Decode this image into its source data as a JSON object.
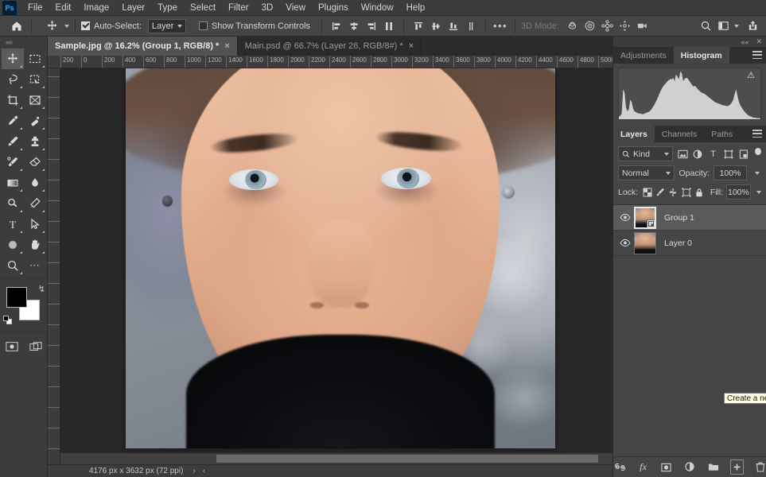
{
  "app": {
    "name": "Adobe Photoshop",
    "logo_text": "Ps"
  },
  "menubar": {
    "items": [
      {
        "label": "File"
      },
      {
        "label": "Edit"
      },
      {
        "label": "Image"
      },
      {
        "label": "Layer"
      },
      {
        "label": "Type"
      },
      {
        "label": "Select"
      },
      {
        "label": "Filter"
      },
      {
        "label": "3D"
      },
      {
        "label": "View"
      },
      {
        "label": "Plugins"
      },
      {
        "label": "Window"
      },
      {
        "label": "Help"
      }
    ]
  },
  "options_bar": {
    "home_icon": "home-icon",
    "tool_icon": "move-tool-icon",
    "auto_select_label": "Auto-Select:",
    "auto_select_checked": true,
    "auto_select_target": "Layer",
    "show_transform_label": "Show Transform Controls",
    "show_transform_checked": false,
    "align_buttons": [
      "align-left-edges",
      "align-horizontal-centers",
      "align-right-edges",
      "align-top-edges",
      "align-vertical-centers",
      "align-bottom-edges",
      "distribute-vertical"
    ],
    "overflow_label": "•••",
    "mode_3d_label": "3D Mode:",
    "mode_3d_icons": [
      "orbit-3d-icon",
      "roll-3d-icon",
      "pan-3d-icon",
      "slide-3d-icon",
      "camera-3d-icon"
    ],
    "search_icon": "search-icon",
    "workspace_icon": "workspace-icon",
    "share_icon": "share-icon"
  },
  "tabs": [
    {
      "title": "Sample.jpg @ 16.2% (Group 1, RGB/8) *",
      "active": true,
      "close": "×"
    },
    {
      "title": "Main.psd @ 66.7% (Layer 26, RGB/8#) *",
      "active": false,
      "close": "×"
    }
  ],
  "toolbar": {
    "collapse_label": "««",
    "tools": [
      {
        "name": "move-tool",
        "active": true
      },
      {
        "name": "rectangular-marquee-tool",
        "active": false
      },
      {
        "name": "lasso-tool",
        "active": false
      },
      {
        "name": "object-selection-tool",
        "active": false
      },
      {
        "name": "crop-tool",
        "active": false
      },
      {
        "name": "frame-tool",
        "active": false
      },
      {
        "name": "eyedropper-tool",
        "active": false
      },
      {
        "name": "spot-healing-brush-tool",
        "active": false
      },
      {
        "name": "brush-tool",
        "active": false
      },
      {
        "name": "clone-stamp-tool",
        "active": false
      },
      {
        "name": "history-brush-tool",
        "active": false
      },
      {
        "name": "eraser-tool",
        "active": false
      },
      {
        "name": "gradient-tool",
        "active": false
      },
      {
        "name": "blur-tool",
        "active": false
      },
      {
        "name": "dodge-tool",
        "active": false
      },
      {
        "name": "pen-tool",
        "active": false
      },
      {
        "name": "horizontal-type-tool",
        "active": false
      },
      {
        "name": "path-selection-tool",
        "active": false
      },
      {
        "name": "ellipse-tool",
        "active": false
      },
      {
        "name": "hand-tool",
        "active": false
      },
      {
        "name": "zoom-tool",
        "active": false
      },
      {
        "name": "edit-toolbar-tool",
        "active": false
      }
    ],
    "foreground_color": "#000000",
    "background_color": "#ffffff",
    "swap_colors_icon": "swap-colors-icon",
    "default_colors_icon": "default-colors-icon",
    "quick_mask_icon": "quick-mask-icon",
    "screen_mode_icon": "screen-mode-icon"
  },
  "rulers": {
    "horizontal_ticks": [
      "200",
      "0",
      "200",
      "400",
      "600",
      "800",
      "1000",
      "1200",
      "1400",
      "1600",
      "1800",
      "2000",
      "2200",
      "2400",
      "2600",
      "2800",
      "3000",
      "3200",
      "3400",
      "3600",
      "3800",
      "4000",
      "4200",
      "4400",
      "4600",
      "4800",
      "5000"
    ]
  },
  "document": {
    "title": "Sample.jpg",
    "zoom": "16.2%",
    "status_text": "4176 px x 3632 px (72 ppi)",
    "status_next_arrow": "›",
    "status_prev_arrow": "‹"
  },
  "dock": {
    "collapse_icon": "««",
    "close_icon": "✕",
    "upper_panel": {
      "tabs": [
        {
          "label": "Adjustments",
          "active": false
        },
        {
          "label": "Histogram",
          "active": true
        }
      ],
      "menu_icon": "panel-menu-icon",
      "warning_icon": "⚠",
      "histogram_values": [
        4,
        6,
        10,
        52,
        46,
        20,
        14,
        17,
        34,
        30,
        18,
        14,
        12,
        11,
        10,
        10,
        9,
        9,
        10,
        11,
        12,
        13,
        15,
        18,
        22,
        26,
        31,
        36,
        42,
        48,
        53,
        57,
        60,
        63,
        66,
        68,
        70,
        69,
        72,
        66,
        78,
        74,
        69,
        83,
        80,
        66,
        70,
        72,
        71,
        68,
        64,
        60,
        57,
        58,
        56,
        53,
        50,
        48,
        46,
        45,
        44,
        42,
        40,
        38,
        36,
        34,
        32,
        30,
        29,
        28,
        27,
        26,
        25,
        24,
        24,
        23,
        23,
        24,
        26,
        29,
        34,
        44,
        52,
        40,
        30,
        24,
        20,
        16,
        13,
        10,
        8,
        6,
        5,
        4,
        3,
        3,
        2,
        2,
        2,
        1
      ]
    },
    "layers_panel": {
      "tabs": [
        {
          "label": "Layers",
          "active": true
        },
        {
          "label": "Channels",
          "active": false
        },
        {
          "label": "Paths",
          "active": false
        }
      ],
      "menu_icon": "panel-menu-icon",
      "filter": {
        "search_icon": "search-icon",
        "kind_label": "Kind",
        "type_filters": [
          "filter-pixel-icon",
          "filter-adjustment-icon",
          "filter-type-icon",
          "filter-shape-icon",
          "filter-smart-object-icon"
        ],
        "toggle_icon": "filter-toggle-icon"
      },
      "blend_mode": "Normal",
      "opacity_label": "Opacity:",
      "opacity_value": "100%",
      "lock_label": "Lock:",
      "lock_buttons": [
        "lock-transparent-pixels-icon",
        "lock-image-pixels-icon",
        "lock-position-icon",
        "lock-artboard-icon",
        "lock-all-icon"
      ],
      "fill_label": "Fill:",
      "fill_value": "100%",
      "layers": [
        {
          "name": "Group 1",
          "visible": true,
          "selected": true,
          "smart_object": true
        },
        {
          "name": "Layer 0",
          "visible": true,
          "selected": false,
          "smart_object": false
        }
      ],
      "footer_buttons": [
        {
          "name": "link-layers-button",
          "glyph": "∞"
        },
        {
          "name": "layer-style-button",
          "glyph": "fx"
        },
        {
          "name": "add-layer-mask-button",
          "glyph": "▣"
        },
        {
          "name": "new-fill-adjustment-button",
          "glyph": "◑"
        },
        {
          "name": "new-group-button",
          "glyph": "▱"
        },
        {
          "name": "new-layer-button",
          "glyph": "+"
        },
        {
          "name": "delete-layer-button",
          "glyph": "Ὕ1"
        }
      ]
    }
  },
  "tooltip": {
    "text": "Create a new l"
  },
  "colors": {
    "menubar_bg": "#3c3c3c",
    "panel_bg": "#454545",
    "app_bg": "#2b2b2b",
    "canvas_bg": "#282828",
    "accent_blue": "#31a8ff",
    "text": "#d4d4d4",
    "selected_layer": "#5a5a5a",
    "tooltip_bg": "#ffffe1"
  }
}
